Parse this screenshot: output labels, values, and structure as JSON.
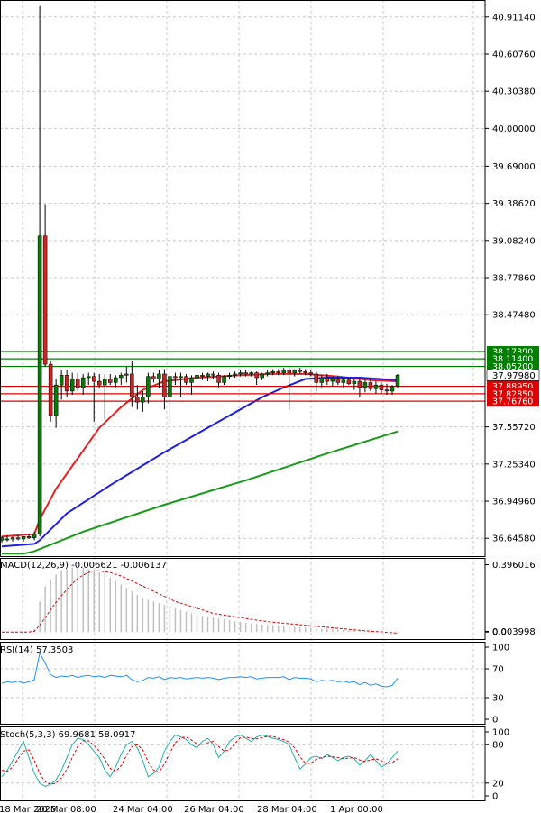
{
  "colors": {
    "background": "#ffffff",
    "grid": "#c8c8c8",
    "frame": "#000000",
    "bull_body": "#008000",
    "bear_body": "#d42020",
    "ma_fast": "#e82020",
    "ma_mid": "#1f1fe0",
    "ma_slow": "#1a9a1a",
    "resistance": "#008000",
    "support": "#e00000",
    "macd_hist": "#c0c0c0",
    "macd_signal": "#e00000",
    "rsi": "#1e90ff",
    "stoch_main": "#20b2aa",
    "stoch_signal": "#e00000"
  },
  "chart_data": [
    {
      "type": "candlestick",
      "pane": "price",
      "ylim": [
        36.5,
        41.05
      ],
      "y_ticks": [
        "40.91140",
        "40.60760",
        "40.30380",
        "40.00000",
        "39.69000",
        "39.38620",
        "39.08240",
        "38.77860",
        "38.47480",
        "38.17390",
        "38.11400",
        "38.05200",
        "37.97980",
        "37.88950",
        "37.82850",
        "37.76760",
        "37.55720",
        "37.25340",
        "36.94960",
        "36.64580"
      ],
      "x_ticks": [
        "18 Mar 2025",
        "20 Mar 08:00",
        "24 Mar 04:00",
        "26 Mar 04:00",
        "28 Mar 04:00",
        "1 Apr 00:00"
      ],
      "candles": [
        {
          "o": 36.63,
          "h": 36.66,
          "l": 36.61,
          "c": 36.65
        },
        {
          "o": 36.64,
          "h": 36.67,
          "l": 36.62,
          "c": 36.64
        },
        {
          "o": 36.64,
          "h": 36.66,
          "l": 36.62,
          "c": 36.65
        },
        {
          "o": 36.65,
          "h": 36.67,
          "l": 36.63,
          "c": 36.64
        },
        {
          "o": 36.64,
          "h": 36.66,
          "l": 36.62,
          "c": 36.66
        },
        {
          "o": 36.66,
          "h": 36.68,
          "l": 36.64,
          "c": 36.65
        },
        {
          "o": 36.65,
          "h": 36.7,
          "l": 36.63,
          "c": 36.68
        },
        {
          "o": 36.68,
          "h": 41.0,
          "l": 36.66,
          "c": 39.12
        },
        {
          "o": 39.12,
          "h": 39.38,
          "l": 38.05,
          "c": 38.07
        },
        {
          "o": 38.07,
          "h": 38.1,
          "l": 37.6,
          "c": 37.65
        },
        {
          "o": 37.65,
          "h": 37.95,
          "l": 37.55,
          "c": 37.9
        },
        {
          "o": 37.9,
          "h": 38.02,
          "l": 37.78,
          "c": 37.98
        },
        {
          "o": 37.98,
          "h": 38.02,
          "l": 37.8,
          "c": 37.85
        },
        {
          "o": 37.85,
          "h": 38.0,
          "l": 37.82,
          "c": 37.95
        },
        {
          "o": 37.95,
          "h": 38.0,
          "l": 37.85,
          "c": 37.88
        },
        {
          "o": 37.88,
          "h": 37.99,
          "l": 37.82,
          "c": 37.96
        },
        {
          "o": 37.96,
          "h": 38.0,
          "l": 37.9,
          "c": 37.97
        },
        {
          "o": 37.97,
          "h": 38.0,
          "l": 37.6,
          "c": 37.93
        },
        {
          "o": 37.93,
          "h": 37.99,
          "l": 37.87,
          "c": 37.9
        },
        {
          "o": 37.9,
          "h": 37.99,
          "l": 37.62,
          "c": 37.95
        },
        {
          "o": 37.95,
          "h": 37.99,
          "l": 37.9,
          "c": 37.92
        },
        {
          "o": 37.92,
          "h": 37.98,
          "l": 37.88,
          "c": 37.96
        },
        {
          "o": 37.96,
          "h": 38.0,
          "l": 37.9,
          "c": 37.98
        },
        {
          "o": 37.98,
          "h": 38.05,
          "l": 37.92,
          "c": 37.99
        },
        {
          "o": 37.99,
          "h": 38.1,
          "l": 37.72,
          "c": 37.8
        },
        {
          "o": 37.8,
          "h": 37.9,
          "l": 37.7,
          "c": 37.76
        },
        {
          "o": 37.76,
          "h": 37.85,
          "l": 37.68,
          "c": 37.8
        },
        {
          "o": 37.8,
          "h": 38.0,
          "l": 37.75,
          "c": 37.97
        },
        {
          "o": 37.97,
          "h": 38.0,
          "l": 37.92,
          "c": 37.95
        },
        {
          "o": 37.95,
          "h": 38.02,
          "l": 37.88,
          "c": 37.99
        },
        {
          "o": 37.99,
          "h": 38.03,
          "l": 37.7,
          "c": 37.8
        },
        {
          "o": 37.8,
          "h": 38.0,
          "l": 37.62,
          "c": 37.97
        },
        {
          "o": 37.97,
          "h": 38.0,
          "l": 37.9,
          "c": 37.96
        },
        {
          "o": 37.96,
          "h": 38.0,
          "l": 37.8,
          "c": 37.97
        },
        {
          "o": 37.97,
          "h": 37.99,
          "l": 37.9,
          "c": 37.92
        },
        {
          "o": 37.92,
          "h": 37.98,
          "l": 37.82,
          "c": 37.96
        },
        {
          "o": 37.96,
          "h": 38.0,
          "l": 37.9,
          "c": 37.98
        },
        {
          "o": 37.98,
          "h": 38.0,
          "l": 37.94,
          "c": 37.97
        },
        {
          "o": 37.97,
          "h": 38.0,
          "l": 37.93,
          "c": 37.99
        },
        {
          "o": 37.99,
          "h": 38.01,
          "l": 37.95,
          "c": 37.98
        },
        {
          "o": 37.98,
          "h": 38.0,
          "l": 37.88,
          "c": 37.92
        },
        {
          "o": 37.92,
          "h": 37.98,
          "l": 37.9,
          "c": 37.97
        },
        {
          "o": 37.97,
          "h": 38.0,
          "l": 37.95,
          "c": 37.98
        },
        {
          "o": 37.98,
          "h": 38.01,
          "l": 37.96,
          "c": 37.99
        },
        {
          "o": 37.99,
          "h": 38.02,
          "l": 37.97,
          "c": 38.0
        },
        {
          "o": 38.0,
          "h": 38.02,
          "l": 37.97,
          "c": 37.99
        },
        {
          "o": 37.99,
          "h": 38.01,
          "l": 37.97,
          "c": 38.0
        },
        {
          "o": 38.0,
          "h": 38.01,
          "l": 37.9,
          "c": 37.96
        },
        {
          "o": 37.96,
          "h": 38.0,
          "l": 37.94,
          "c": 37.99
        },
        {
          "o": 37.99,
          "h": 38.02,
          "l": 37.97,
          "c": 38.0
        },
        {
          "o": 38.0,
          "h": 38.03,
          "l": 37.98,
          "c": 38.01
        },
        {
          "o": 38.01,
          "h": 38.03,
          "l": 37.98,
          "c": 38.0
        },
        {
          "o": 38.0,
          "h": 38.04,
          "l": 37.98,
          "c": 38.02
        },
        {
          "o": 38.02,
          "h": 38.04,
          "l": 37.7,
          "c": 38.0
        },
        {
          "o": 38.0,
          "h": 38.03,
          "l": 37.97,
          "c": 38.02
        },
        {
          "o": 38.02,
          "h": 38.04,
          "l": 37.99,
          "c": 38.01
        },
        {
          "o": 38.01,
          "h": 38.03,
          "l": 37.98,
          "c": 38.0
        },
        {
          "o": 38.0,
          "h": 38.02,
          "l": 37.97,
          "c": 37.99
        },
        {
          "o": 37.99,
          "h": 38.01,
          "l": 37.85,
          "c": 37.92
        },
        {
          "o": 37.92,
          "h": 37.98,
          "l": 37.88,
          "c": 37.96
        },
        {
          "o": 37.96,
          "h": 37.99,
          "l": 37.9,
          "c": 37.93
        },
        {
          "o": 37.93,
          "h": 37.97,
          "l": 37.89,
          "c": 37.95
        },
        {
          "o": 37.95,
          "h": 37.97,
          "l": 37.9,
          "c": 37.92
        },
        {
          "o": 37.92,
          "h": 37.96,
          "l": 37.88,
          "c": 37.94
        },
        {
          "o": 37.94,
          "h": 37.96,
          "l": 37.9,
          "c": 37.91
        },
        {
          "o": 37.91,
          "h": 37.95,
          "l": 37.86,
          "c": 37.93
        },
        {
          "o": 37.93,
          "h": 37.95,
          "l": 37.8,
          "c": 37.88
        },
        {
          "o": 37.88,
          "h": 37.94,
          "l": 37.84,
          "c": 37.92
        },
        {
          "o": 37.92,
          "h": 37.95,
          "l": 37.85,
          "c": 37.87
        },
        {
          "o": 37.87,
          "h": 37.93,
          "l": 37.83,
          "c": 37.9
        },
        {
          "o": 37.9,
          "h": 37.92,
          "l": 37.83,
          "c": 37.86
        },
        {
          "o": 37.86,
          "h": 37.91,
          "l": 37.82,
          "c": 37.85
        },
        {
          "o": 37.85,
          "h": 37.9,
          "l": 37.82,
          "c": 37.89
        },
        {
          "o": 37.89,
          "h": 37.99,
          "l": 37.87,
          "c": 37.98
        }
      ],
      "moving_averages": [
        {
          "role": "fast",
          "points": [
            [
              0,
              36.66
            ],
            [
              6,
              36.68
            ],
            [
              7,
              36.8
            ],
            [
              10,
              37.05
            ],
            [
              14,
              37.3
            ],
            [
              18,
              37.55
            ],
            [
              22,
              37.72
            ],
            [
              26,
              37.86
            ],
            [
              30,
              37.93
            ],
            [
              36,
              37.96
            ],
            [
              44,
              37.98
            ],
            [
              50,
              37.99
            ],
            [
              56,
              37.99
            ],
            [
              62,
              37.97
            ],
            [
              68,
              37.94
            ],
            [
              73,
              37.93
            ]
          ]
        },
        {
          "role": "mid",
          "points": [
            [
              0,
              36.58
            ],
            [
              6,
              36.6
            ],
            [
              7,
              36.63
            ],
            [
              12,
              36.85
            ],
            [
              20,
              37.08
            ],
            [
              30,
              37.35
            ],
            [
              40,
              37.6
            ],
            [
              48,
              37.8
            ],
            [
              52,
              37.88
            ],
            [
              56,
              37.95
            ],
            [
              60,
              37.96
            ],
            [
              66,
              37.96
            ],
            [
              73,
              37.94
            ]
          ]
        },
        {
          "role": "slow",
          "points": [
            [
              0,
              36.52
            ],
            [
              4,
              36.52
            ],
            [
              6,
              36.54
            ],
            [
              15,
              36.7
            ],
            [
              30,
              36.92
            ],
            [
              45,
              37.12
            ],
            [
              60,
              37.34
            ],
            [
              73,
              37.52
            ]
          ]
        }
      ],
      "horizontal_lines": [
        {
          "kind": "resistance",
          "value": 38.1739,
          "label": "38.17390"
        },
        {
          "kind": "resistance",
          "value": 38.114,
          "label": "38.11400"
        },
        {
          "kind": "resistance",
          "value": 38.052,
          "label": "38.05200"
        },
        {
          "kind": "support",
          "value": 37.8895,
          "label": "37.88950"
        },
        {
          "kind": "support",
          "value": 37.8285,
          "label": "37.82850"
        },
        {
          "kind": "support",
          "value": 37.7676,
          "label": "37.76760"
        }
      ],
      "current_price": {
        "value": 37.9798,
        "label": "37.97980"
      }
    },
    {
      "type": "bar",
      "pane": "macd",
      "title": "MACD(12,26,9) -0.006621 -0.006137",
      "y_ticks": [
        "0.396016",
        "0.003998",
        "0.0"
      ],
      "ylim": [
        -0.02,
        0.42
      ],
      "histogram": [
        0.0,
        0.0,
        0.0,
        0.0,
        0.0,
        0.0,
        0.02,
        0.18,
        0.27,
        0.31,
        0.34,
        0.36,
        0.37,
        0.38,
        0.38,
        0.38,
        0.37,
        0.36,
        0.35,
        0.34,
        0.32,
        0.3,
        0.28,
        0.26,
        0.24,
        0.22,
        0.2,
        0.19,
        0.18,
        0.17,
        0.16,
        0.15,
        0.14,
        0.13,
        0.12,
        0.11,
        0.1,
        0.095,
        0.09,
        0.085,
        0.08,
        0.075,
        0.07,
        0.065,
        0.06,
        0.055,
        0.05,
        0.048,
        0.045,
        0.042,
        0.04,
        0.038,
        0.035,
        0.032,
        0.03,
        0.028,
        0.026,
        0.024,
        0.022,
        0.02,
        0.018,
        0.016,
        0.014,
        0.012,
        0.01,
        0.008,
        0.006,
        0.005,
        0.003,
        0.002,
        0.0,
        -0.002,
        -0.004,
        -0.006
      ],
      "signal": [
        0.0,
        0.0,
        0.0,
        0.0,
        0.0,
        0.0,
        0.005,
        0.04,
        0.085,
        0.13,
        0.175,
        0.215,
        0.25,
        0.285,
        0.315,
        0.335,
        0.35,
        0.36,
        0.36,
        0.355,
        0.35,
        0.34,
        0.33,
        0.315,
        0.3,
        0.285,
        0.27,
        0.255,
        0.24,
        0.225,
        0.21,
        0.195,
        0.18,
        0.17,
        0.16,
        0.15,
        0.14,
        0.13,
        0.12,
        0.11,
        0.105,
        0.1,
        0.095,
        0.09,
        0.085,
        0.08,
        0.075,
        0.07,
        0.066,
        0.062,
        0.058,
        0.055,
        0.052,
        0.049,
        0.046,
        0.043,
        0.04,
        0.037,
        0.034,
        0.031,
        0.028,
        0.025,
        0.022,
        0.019,
        0.016,
        0.013,
        0.01,
        0.008,
        0.005,
        0.003,
        0.001,
        -0.002,
        -0.004,
        -0.006
      ]
    },
    {
      "type": "line",
      "pane": "rsi",
      "title": "RSI(14) 57.3503",
      "y_ticks": [
        "100",
        "70",
        "30",
        "0"
      ],
      "ylim": [
        0,
        100
      ],
      "rsi": [
        50,
        52,
        51,
        53,
        50,
        52,
        55,
        92,
        78,
        62,
        58,
        60,
        59,
        61,
        58,
        60,
        61,
        59,
        60,
        58,
        61,
        60,
        59,
        61,
        55,
        52,
        54,
        58,
        57,
        59,
        55,
        58,
        57,
        58,
        56,
        57,
        58,
        57,
        58,
        57,
        55,
        57,
        58,
        58,
        59,
        58,
        59,
        56,
        57,
        58,
        58,
        58,
        59,
        55,
        58,
        57,
        57,
        56,
        52,
        54,
        53,
        54,
        52,
        53,
        51,
        52,
        48,
        51,
        47,
        49,
        46,
        45,
        47,
        57
      ]
    },
    {
      "type": "line",
      "pane": "stoch",
      "title": "Stoch(5,3,3) 69.9681 58.0917",
      "y_ticks": [
        "100",
        "80",
        "20",
        "0"
      ],
      "ylim": [
        0,
        100
      ],
      "main": [
        30,
        40,
        55,
        70,
        85,
        60,
        35,
        20,
        15,
        18,
        25,
        40,
        60,
        80,
        90,
        88,
        80,
        70,
        60,
        40,
        30,
        45,
        65,
        80,
        85,
        75,
        55,
        30,
        35,
        45,
        70,
        85,
        95,
        92,
        88,
        80,
        75,
        85,
        90,
        80,
        60,
        70,
        85,
        92,
        95,
        90,
        85,
        92,
        95,
        93,
        90,
        88,
        85,
        80,
        60,
        42,
        50,
        60,
        62,
        58,
        65,
        60,
        55,
        60,
        62,
        58,
        48,
        55,
        65,
        55,
        45,
        50,
        60,
        70
      ],
      "signal": [
        40,
        38,
        45,
        58,
        70,
        72,
        55,
        35,
        22,
        18,
        20,
        28,
        42,
        60,
        77,
        86,
        86,
        79,
        70,
        57,
        43,
        38,
        47,
        63,
        77,
        80,
        72,
        53,
        40,
        37,
        50,
        67,
        83,
        91,
        92,
        87,
        81,
        80,
        83,
        85,
        77,
        70,
        72,
        82,
        91,
        92,
        90,
        89,
        91,
        93,
        93,
        90,
        88,
        84,
        75,
        61,
        51,
        51,
        57,
        60,
        62,
        61,
        60,
        58,
        59,
        60,
        56,
        54,
        56,
        58,
        55,
        50,
        52,
        58
      ]
    }
  ]
}
